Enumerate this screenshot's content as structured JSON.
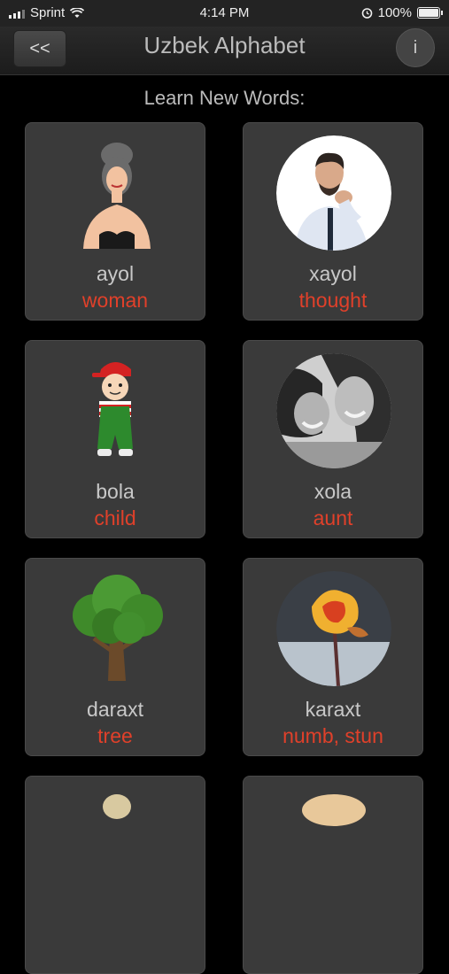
{
  "status_bar": {
    "carrier": "Sprint",
    "time": "4:14 PM",
    "battery": "100%"
  },
  "nav": {
    "back_label": "<<",
    "title": "Uzbek Alphabet",
    "info_label": "i"
  },
  "section_title": "Learn New Words:",
  "cards": [
    {
      "word": "ayol",
      "translation": "woman",
      "picture": "woman-cartoon"
    },
    {
      "word": "xayol",
      "translation": "thought",
      "picture": "thinking-man-photo"
    },
    {
      "word": "bola",
      "translation": "child",
      "picture": "boy-cartoon"
    },
    {
      "word": "xola",
      "translation": "aunt",
      "picture": "woman-and-girl-photo"
    },
    {
      "word": "daraxt",
      "translation": "tree",
      "picture": "tree-illustration"
    },
    {
      "word": "karaxt",
      "translation": "numb, stun",
      "picture": "frozen-rose-photo"
    }
  ],
  "colors": {
    "translation": "#e0402a",
    "card_bg": "#3a3a3a",
    "background": "#000000"
  }
}
